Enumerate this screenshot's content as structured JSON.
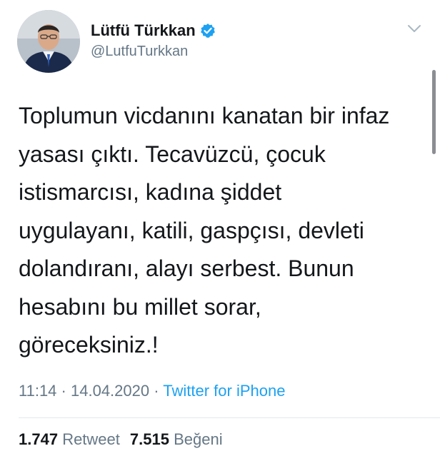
{
  "author": {
    "display_name": "Lütfü Türkkan",
    "username": "@LutfuTurkkan",
    "avatar_icon": "profile-photo"
  },
  "icons": {
    "verified": "verified-badge-icon",
    "menu": "chevron-down-icon"
  },
  "tweet": {
    "text": "Toplumun vicdanını kanatan bir infaz\nyasası çıktı. Tecavüzcü, çocuk\nistismarcısı, kadına şiddet\nuygulayanı, katili, gaspçısı, devleti\ndolandıranı, alayı serbest. Bunun\nhesabını bu millet sorar,\ngöreceksiniz.!",
    "time": "11:14",
    "separator": "·",
    "date": "14.04.2020",
    "source": "Twitter for iPhone"
  },
  "stats": {
    "retweets_count": "1.747",
    "retweets_label": "Retweet",
    "likes_count": "7.515",
    "likes_label": "Beğeni"
  },
  "colors": {
    "text": "#14171a",
    "secondary": "#657786",
    "accent": "#1da1f2"
  }
}
